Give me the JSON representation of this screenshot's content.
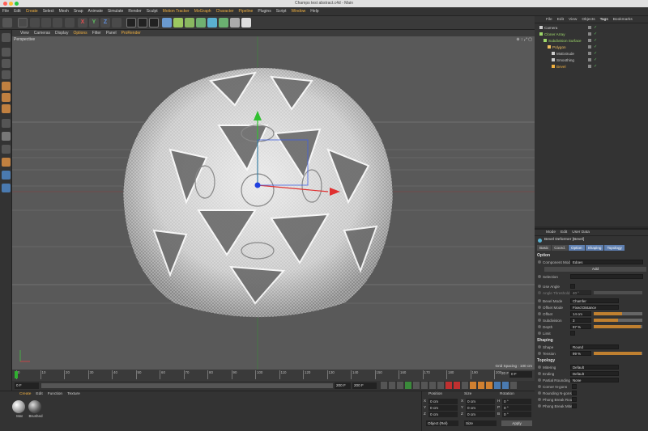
{
  "window": {
    "title": "Champs test abstract.c4d - Main"
  },
  "menubar": {
    "items": [
      "File",
      "Edit",
      "Create",
      "Select",
      "Mesh",
      "Snap",
      "Animate",
      "Simulate",
      "Render",
      "Sculpt",
      "Motion Tracker",
      "MoGraph",
      "Character",
      "Pipeline",
      "Plugins",
      "Script",
      "Window",
      "Help"
    ],
    "highlight": [
      "Create",
      "Motion Tracker",
      "MoGraph",
      "Character",
      "Pipeline",
      "Window"
    ]
  },
  "toolbar": {
    "axis_x": "X",
    "axis_y": "Y",
    "axis_z": "Z"
  },
  "viewport": {
    "menus": [
      "View",
      "Cameras",
      "Display",
      "Options",
      "Filter",
      "Panel",
      "ProRender"
    ],
    "label": "Perspective",
    "grid_spacing": "Grid Spacing : 100 cm"
  },
  "timeline": {
    "ticks": [
      "0",
      "10",
      "20",
      "30",
      "40",
      "50",
      "60",
      "70",
      "80",
      "90",
      "100",
      "110",
      "120",
      "130",
      "140",
      "150",
      "160",
      "170",
      "180",
      "190",
      "200"
    ],
    "end_frame": "20 F",
    "frame_field": "0 F"
  },
  "playbar": {
    "start": "0 F",
    "current": "0 F",
    "end_a": "200 F",
    "end_b": "200 F"
  },
  "material": {
    "menus": [
      "Create",
      "Edit",
      "Function",
      "Texture"
    ],
    "items": [
      "Mat",
      "Brushed"
    ]
  },
  "coords": {
    "headers": [
      "Position",
      "Size",
      "Rotation"
    ],
    "rows": [
      {
        "axis": "X",
        "pos": "0 cm",
        "size_axis": "X",
        "size": "0 cm",
        "rot_axis": "H",
        "rot": "0 °"
      },
      {
        "axis": "Y",
        "pos": "0 cm",
        "size_axis": "Y",
        "size": "0 cm",
        "rot_axis": "P",
        "rot": "0 °"
      },
      {
        "axis": "Z",
        "pos": "0 cm",
        "size_axis": "Z",
        "size": "0 cm",
        "rot_axis": "B",
        "rot": "0 °"
      }
    ],
    "mode_left": "Object (Rel)",
    "mode_mid": "Size",
    "apply": "Apply"
  },
  "objects": {
    "menus": [
      "File",
      "Edit",
      "View",
      "Objects",
      "Tags",
      "Bookmarks"
    ],
    "tree": [
      {
        "name": "Camera",
        "indent": 0,
        "color": "#cccccc"
      },
      {
        "name": "Cloner Array",
        "indent": 0,
        "color": "#9ed86a"
      },
      {
        "name": "Subdivision Surface",
        "indent": 1,
        "color": "#9ed86a"
      },
      {
        "name": "Polygon",
        "indent": 2,
        "color": "#f0c060"
      },
      {
        "name": "MxExtrude",
        "indent": 3,
        "color": "#cccccc"
      },
      {
        "name": "Smoothing",
        "indent": 3,
        "color": "#cccccc"
      },
      {
        "name": "Bevel",
        "indent": 3,
        "color": "#f0b040"
      }
    ]
  },
  "attributes": {
    "menus": [
      "Mode",
      "Edit",
      "User Data"
    ],
    "object_label": "Bevel Deformer [Bevel]",
    "tabs": [
      "Basic",
      "Coord.",
      "Option",
      "Shaping",
      "Topology"
    ],
    "active_tabs": [
      "Option",
      "Shaping",
      "Topology"
    ],
    "section_option": "Option",
    "component_mode": {
      "label": "Component Mode",
      "value": "Edges"
    },
    "add_label": "Add",
    "selection_label": "Selection",
    "use_angle_label": "Use Angle",
    "angle_threshold": {
      "label": "Angle Threshold",
      "value": "40 °"
    },
    "bevel_mode": {
      "label": "Bevel Mode",
      "value": "Chamfer"
    },
    "offset_mode": {
      "label": "Offset Mode",
      "value": "Fixed Distance"
    },
    "offset": {
      "label": "Offset",
      "value": "14 cm"
    },
    "subdivision": {
      "label": "Subdivision",
      "value": "3"
    },
    "depth": {
      "label": "Depth",
      "value": "97 %"
    },
    "limit_label": "Limit",
    "section_shaping": "Shaping",
    "shape": {
      "label": "Shape",
      "value": "Round"
    },
    "tension": {
      "label": "Tension",
      "value": "99 %"
    },
    "section_topology": "Topology",
    "mitering": {
      "label": "Mitering",
      "value": "Default"
    },
    "ending": {
      "label": "Ending",
      "value": "Default"
    },
    "partial_rounding": {
      "label": "Partial Rounding",
      "value": "None"
    },
    "checks": [
      "Corner N-gons",
      "Rounding N-gons",
      "Phong Break Rounding",
      "Phong Break Miters"
    ]
  }
}
